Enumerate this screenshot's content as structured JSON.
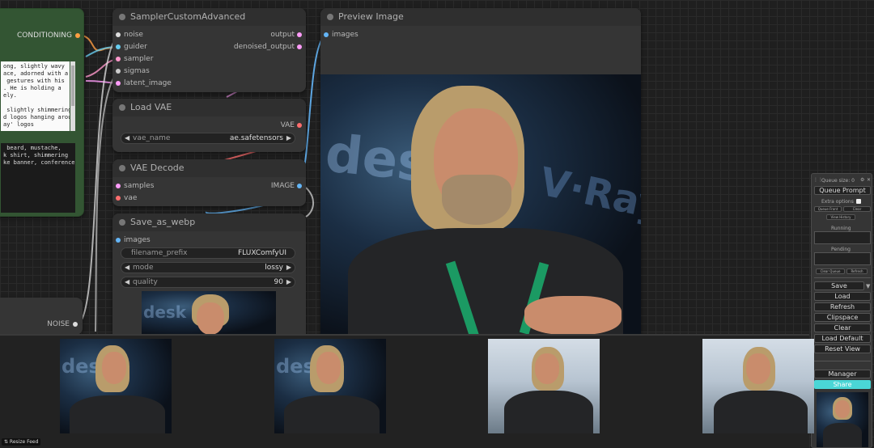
{
  "conditioning_node": {
    "output_label": "CONDITIONING",
    "prompt_text": "ong, slightly wavy\nace, adorned with a\n gestures with his\n. He is holding a\nely.\n\n slightly shimmering\nd logos hanging around\nay' logos",
    "prompt_text_2": " beard, mustache,\nk shirt, shimmering\nke banner, conference,"
  },
  "noise_node": {
    "output_label": "NOISE"
  },
  "sampler_node": {
    "title": "SamplerCustomAdvanced",
    "inputs": [
      "noise",
      "guider",
      "sampler",
      "sigmas",
      "latent_image"
    ],
    "outputs": [
      "output",
      "denoised_output"
    ]
  },
  "load_vae_node": {
    "title": "Load VAE",
    "output_label": "VAE",
    "widget_label": "vae_name",
    "widget_value": "ae.safetensors"
  },
  "vae_decode_node": {
    "title": "VAE Decode",
    "inputs": [
      "samples",
      "vae"
    ],
    "output_label": "IMAGE"
  },
  "save_webp_node": {
    "title": "Save_as_webp",
    "input_label": "images",
    "filename_label": "filename_prefix",
    "filename_value": "FLUXComfyUI",
    "mode_label": "mode",
    "mode_value": "lossy",
    "quality_label": "quality",
    "quality_value": "90"
  },
  "preview_node": {
    "title": "Preview Image",
    "input_label": "images"
  },
  "queue_panel": {
    "queue_size": "Queue size: 0",
    "queue_prompt": "Queue Prompt",
    "extra_options": "Extra options",
    "queue_front": "Queue Front",
    "clear_mini": "Clear",
    "view_history": "View History",
    "running": "Running",
    "pending": "Pending",
    "clear_queue": "Clear Queue",
    "refresh_mini": "Refresh",
    "save": "Save",
    "load": "Load",
    "refresh": "Refresh",
    "clipspace": "Clipspace",
    "clear": "Clear",
    "load_default": "Load Default",
    "reset_view": "Reset View",
    "manager": "Manager",
    "share": "Share"
  },
  "feed": {
    "resize_label": "⇅ Resize Feed"
  },
  "colors": {
    "conditioning": "#ff9f43",
    "noise": "#ffffff",
    "guider": "#66ccee",
    "sampler": "#ff99cc",
    "sigmas": "#cccccc",
    "latent": "#ff9cf9",
    "vae": "#ff6e6e",
    "image": "#64b5f6",
    "share": "#4ad6d6"
  }
}
